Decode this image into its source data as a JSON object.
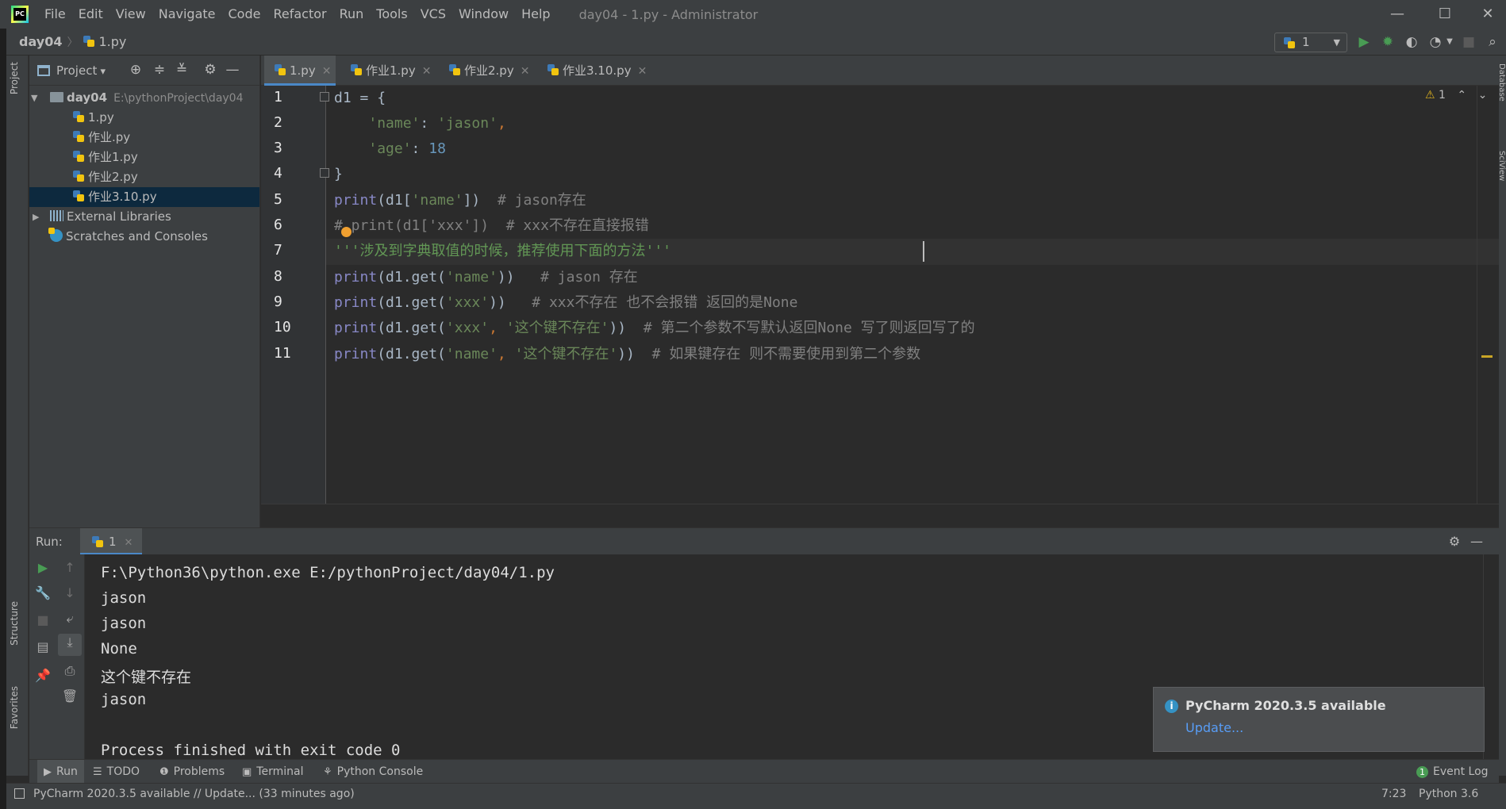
{
  "menu": {
    "items": [
      "File",
      "Edit",
      "View",
      "Navigate",
      "Code",
      "Refactor",
      "Run",
      "Tools",
      "VCS",
      "Window",
      "Help"
    ],
    "window_title": "day04 - 1.py - Administrator",
    "controls": {
      "minimize": "—",
      "maximize": "☐",
      "close": "✕"
    }
  },
  "breadcrumb": {
    "project": "day04",
    "file": "1.py"
  },
  "run_config": {
    "name": "1"
  },
  "project_panel": {
    "title": "Project",
    "root": {
      "name": "day04",
      "path": "E:\\pythonProject\\day04"
    },
    "files": [
      "1.py",
      "作业.py",
      "作业1.py",
      "作业2.py",
      "作业3.10.py"
    ],
    "selected_file": "作业3.10.py",
    "external_libraries": "External Libraries",
    "scratches": "Scratches and Consoles"
  },
  "side_strips": {
    "left_top": "Project",
    "left_structure": "Structure",
    "left_favorites": "Favorites",
    "right_database": "Database",
    "right_sciview": "SciView"
  },
  "editor": {
    "tabs": [
      {
        "label": "1.py",
        "active": true
      },
      {
        "label": "作业1.py",
        "active": false
      },
      {
        "label": "作业2.py",
        "active": false
      },
      {
        "label": "作业3.10.py",
        "active": false
      }
    ],
    "inspection": {
      "warnings": "1"
    },
    "line_numbers": [
      "1",
      "2",
      "3",
      "4",
      "5",
      "6",
      "7",
      "8",
      "9",
      "10",
      "11"
    ],
    "lines": [
      [
        {
          "t": "d1 ",
          "c": ""
        },
        {
          "t": "=",
          "c": ""
        },
        {
          "t": " {",
          "c": ""
        }
      ],
      [
        {
          "t": "    ",
          "c": ""
        },
        {
          "t": "'name'",
          "c": "str"
        },
        {
          "t": ": ",
          "c": ""
        },
        {
          "t": "'jason'",
          "c": "str"
        },
        {
          "t": ",",
          "c": "key"
        }
      ],
      [
        {
          "t": "    ",
          "c": ""
        },
        {
          "t": "'age'",
          "c": "str"
        },
        {
          "t": ": ",
          "c": ""
        },
        {
          "t": "18",
          "c": "num"
        }
      ],
      [
        {
          "t": "}",
          "c": ""
        }
      ],
      [
        {
          "t": "print",
          "c": "kw-fn"
        },
        {
          "t": "(d1[",
          "c": ""
        },
        {
          "t": "'name'",
          "c": "str"
        },
        {
          "t": "])  ",
          "c": ""
        },
        {
          "t": "# jason存在",
          "c": "cmt"
        }
      ],
      [
        {
          "t": "#",
          "c": "cmt"
        },
        {
          "t": " print(d1['xxx'])  # xxx不存在直接报错",
          "c": "cmt"
        }
      ],
      [
        {
          "t": "'''涉及到字典取值的时候，推荐使用下面的方法'''",
          "c": "doc"
        }
      ],
      [
        {
          "t": "print",
          "c": "kw-fn"
        },
        {
          "t": "(d1.get(",
          "c": ""
        },
        {
          "t": "'name'",
          "c": "str"
        },
        {
          "t": "))   ",
          "c": ""
        },
        {
          "t": "# jason 存在",
          "c": "cmt"
        }
      ],
      [
        {
          "t": "print",
          "c": "kw-fn"
        },
        {
          "t": "(d1.get(",
          "c": ""
        },
        {
          "t": "'xxx'",
          "c": "str"
        },
        {
          "t": "))   ",
          "c": ""
        },
        {
          "t": "# xxx不存在 也不会报错 返回的是None",
          "c": "cmt"
        }
      ],
      [
        {
          "t": "print",
          "c": "kw-fn"
        },
        {
          "t": "(d1.get(",
          "c": ""
        },
        {
          "t": "'xxx'",
          "c": "str"
        },
        {
          "t": ", ",
          "c": "key"
        },
        {
          "t": "'这个键不存在'",
          "c": "str"
        },
        {
          "t": "))  ",
          "c": ""
        },
        {
          "t": "# 第二个参数不写默认返回None 写了则返回写了的",
          "c": "cmt"
        }
      ],
      [
        {
          "t": "print",
          "c": "kw-fn"
        },
        {
          "t": "(d1.get(",
          "c": ""
        },
        {
          "t": "'name'",
          "c": "str"
        },
        {
          "t": ", ",
          "c": "key"
        },
        {
          "t": "'这个键不存在'",
          "c": "str"
        },
        {
          "t": "))  ",
          "c": ""
        },
        {
          "t": "# 如果键存在 则不需要使用到第二个参数",
          "c": "cmt"
        }
      ]
    ]
  },
  "run_panel": {
    "label": "Run:",
    "tab": "1",
    "console": [
      "F:\\Python36\\python.exe E:/pythonProject/day04/1.py",
      "jason",
      "jason",
      "None",
      "这个键不存在",
      "jason",
      "",
      "Process finished with exit code 0"
    ]
  },
  "notification": {
    "title": "PyCharm 2020.3.5 available",
    "link": "Update..."
  },
  "tool_tabs": {
    "run": "Run",
    "todo": "TODO",
    "problems": "Problems",
    "terminal": "Terminal",
    "python_console": "Python Console",
    "event_log": "Event Log"
  },
  "status_bar": {
    "message": "PyCharm 2020.3.5 available // Update... (33 minutes ago)",
    "position": "7:23",
    "interpreter": "Python 3.6"
  },
  "colors": {
    "accent": "#4a88c7",
    "selection": "#0d293e",
    "run_green": "#499c54"
  }
}
